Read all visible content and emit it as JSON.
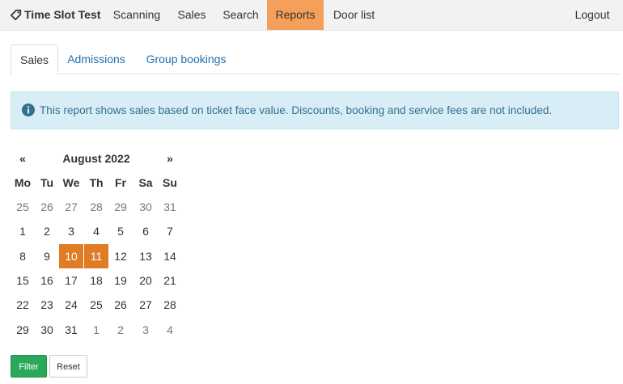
{
  "navbar": {
    "brand": "Time Slot Test",
    "items": [
      {
        "label": "Scanning"
      },
      {
        "label": "Sales"
      },
      {
        "label": "Search"
      },
      {
        "label": "Reports"
      },
      {
        "label": "Door list"
      }
    ],
    "logout": "Logout",
    "active_color": "#f5a05a"
  },
  "tabs": [
    {
      "label": "Sales"
    },
    {
      "label": "Admissions"
    },
    {
      "label": "Group bookings"
    }
  ],
  "alert": {
    "text": "This report shows sales based on ticket face value. Discounts, booking and service fees are not included.",
    "icon": "info-circle-icon"
  },
  "calendar": {
    "prev": "«",
    "next": "»",
    "title": "August 2022",
    "weekdays": [
      "Mo",
      "Tu",
      "We",
      "Th",
      "Fr",
      "Sa",
      "Su"
    ],
    "weeks": [
      [
        "25",
        "26",
        "27",
        "28",
        "29",
        "30",
        "31"
      ],
      [
        "1",
        "2",
        "3",
        "4",
        "5",
        "6",
        "7"
      ],
      [
        "8",
        "9",
        "10",
        "11",
        "12",
        "13",
        "14"
      ],
      [
        "15",
        "16",
        "17",
        "18",
        "19",
        "20",
        "21"
      ],
      [
        "22",
        "23",
        "24",
        "25",
        "26",
        "27",
        "28"
      ],
      [
        "29",
        "30",
        "31",
        "1",
        "2",
        "3",
        "4"
      ]
    ],
    "selected_color": "#e07b26"
  },
  "actions": {
    "filter": "Filter",
    "reset": "Reset"
  }
}
